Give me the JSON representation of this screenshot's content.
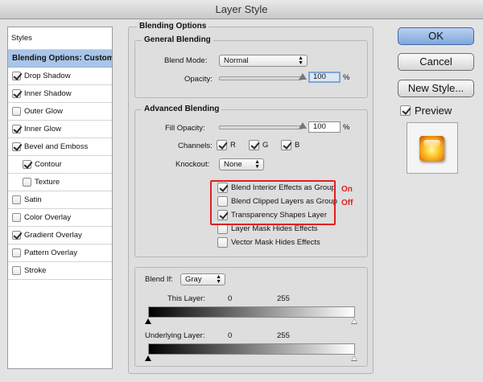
{
  "window": {
    "title": "Layer Style"
  },
  "styles_panel": {
    "header": "Styles",
    "selected": "Blending Options: Custom",
    "items": [
      {
        "label": "Drop Shadow",
        "checked": true,
        "indent": false
      },
      {
        "label": "Inner Shadow",
        "checked": true,
        "indent": false
      },
      {
        "label": "Outer Glow",
        "checked": false,
        "indent": false
      },
      {
        "label": "Inner Glow",
        "checked": true,
        "indent": false
      },
      {
        "label": "Bevel and Emboss",
        "checked": true,
        "indent": false
      },
      {
        "label": "Contour",
        "checked": true,
        "indent": true
      },
      {
        "label": "Texture",
        "checked": false,
        "indent": true
      },
      {
        "label": "Satin",
        "checked": false,
        "indent": false
      },
      {
        "label": "Color Overlay",
        "checked": false,
        "indent": false
      },
      {
        "label": "Gradient Overlay",
        "checked": true,
        "indent": false
      },
      {
        "label": "Pattern Overlay",
        "checked": false,
        "indent": false
      },
      {
        "label": "Stroke",
        "checked": false,
        "indent": false
      }
    ]
  },
  "blending_options": {
    "title": "Blending Options",
    "general": {
      "title": "General Blending",
      "blend_mode_label": "Blend Mode:",
      "blend_mode_value": "Normal",
      "opacity_label": "Opacity:",
      "opacity_value": "100",
      "opacity_unit": "%",
      "opacity_level": 100
    },
    "advanced": {
      "title": "Advanced Blending",
      "fill_opacity_label": "Fill Opacity:",
      "fill_opacity_value": "100",
      "fill_opacity_unit": "%",
      "fill_opacity_level": 100,
      "channels_label": "Channels:",
      "channel_r": "R",
      "channel_g": "G",
      "channel_b": "B",
      "knockout_label": "Knockout:",
      "knockout_value": "None",
      "options": [
        {
          "label": "Blend Interior Effects as Group",
          "checked": true
        },
        {
          "label": "Blend Clipped Layers as Group",
          "checked": false
        },
        {
          "label": "Transparency Shapes Layer",
          "checked": true
        },
        {
          "label": "Layer Mask Hides Effects",
          "checked": false
        },
        {
          "label": "Vector Mask Hides Effects",
          "checked": false
        }
      ],
      "annotation_on": "On",
      "annotation_off": "Off"
    },
    "blend_if": {
      "label": "Blend If:",
      "value": "Gray",
      "this_layer_label": "This Layer:",
      "this_layer_min": "0",
      "this_layer_max": "255",
      "underlying_label": "Underlying Layer:",
      "underlying_min": "0",
      "underlying_max": "255"
    }
  },
  "buttons": {
    "ok": "OK",
    "cancel": "Cancel",
    "new_style": "New Style...",
    "preview_label": "Preview",
    "preview_checked": true
  },
  "colors": {
    "selected_row": "#a9c6e8",
    "annotation": "#e02020",
    "ok_button": "#7ea8da"
  }
}
